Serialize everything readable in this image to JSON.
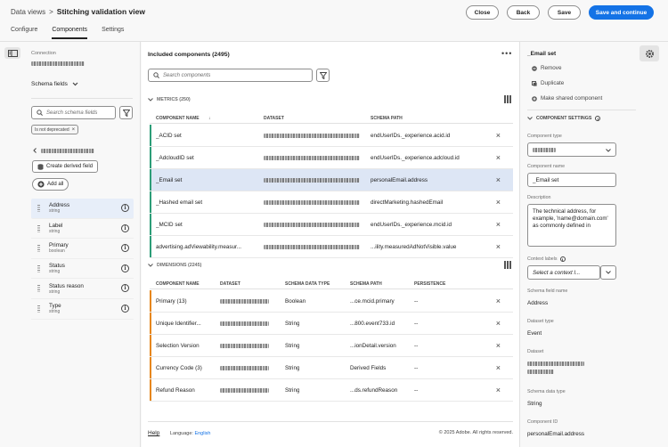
{
  "header": {
    "breadcrumb_root": "Data views",
    "breadcrumb_sep": ">",
    "title": "Stitching validation view",
    "close_label": "Close",
    "back_label": "Back",
    "save_label": "Save",
    "save_continue_label": "Save and continue",
    "tabs": [
      "Configure",
      "Components",
      "Settings"
    ]
  },
  "left": {
    "connection_label": "Connection",
    "schema_fields_label": "Schema fields",
    "search_placeholder": "Search schema fields",
    "filter_tag": "Is not deprecated",
    "create_derived_label": "Create derived field",
    "add_all_label": "Add all",
    "fields": [
      {
        "name": "Address",
        "type": "string"
      },
      {
        "name": "Label",
        "type": "string"
      },
      {
        "name": "Primary",
        "type": "boolean"
      },
      {
        "name": "Status",
        "type": "string"
      },
      {
        "name": "Status reason",
        "type": "string"
      },
      {
        "name": "Type",
        "type": "string"
      }
    ]
  },
  "center": {
    "title": "Included components (2495)",
    "search_placeholder": "Search components",
    "metrics_label": "METRICS (250)",
    "metrics_cols": [
      "COMPONENT NAME",
      "DATASET",
      "SCHEMA PATH"
    ],
    "metrics": [
      {
        "name": "_ACID set",
        "path": "endUserIDs._experience.acid.id"
      },
      {
        "name": "_AdcloudID set",
        "path": "endUserIDs._experience.adcloud.id"
      },
      {
        "name": "_Email set",
        "path": "personalEmail.address"
      },
      {
        "name": "_Hashed email set",
        "path": "directMarketing.hashedEmail"
      },
      {
        "name": "_MCID set",
        "path": "endUserIDs._experience.mcid.id"
      },
      {
        "name": "advertising.adViewability.measur...",
        "path": "...ility.measuredAdNotVisible.value"
      }
    ],
    "dimensions_label": "DIMENSIONS (2245)",
    "dimensions_cols": [
      "COMPONENT NAME",
      "DATASET",
      "SCHEMA DATA TYPE",
      "SCHEMA PATH",
      "PERSISTENCE"
    ],
    "dimensions": [
      {
        "name": "Primary (13)",
        "type": "Boolean",
        "path": "...ce.mcid.primary",
        "persist": "--"
      },
      {
        "name": "Unique Identifier...",
        "type": "String",
        "path": "...800.event733.id",
        "persist": "--"
      },
      {
        "name": "Selection Version",
        "type": "String",
        "path": "...ionDetail.version",
        "persist": "--"
      },
      {
        "name": "Currency Code (3)",
        "type": "String",
        "path": "Derived Fields",
        "persist": "--"
      },
      {
        "name": "Refund Reason",
        "type": "String",
        "path": "...ds.refundReason",
        "persist": "--"
      }
    ],
    "help_label": "Help",
    "language_label": "Language:",
    "language_value": "English",
    "copyright": "© 2025 Adobe. All rights reserved."
  },
  "right": {
    "title": "_Email set",
    "remove_label": "Remove",
    "duplicate_label": "Duplicate",
    "shared_label": "Make shared component",
    "settings_label": "COMPONENT SETTINGS",
    "type_label": "Component type",
    "name_label": "Component name",
    "name_value": "_Email set",
    "desc_label": "Description",
    "desc_value": "The technical address, for example, 'name@domain.com' as commonly defined in",
    "context_label": "Context labels",
    "context_placeholder": "Select a context l...",
    "schema_field_name_label": "Schema field name",
    "schema_field_name_value": "Address",
    "dataset_type_label": "Dataset type",
    "dataset_type_value": "Event",
    "dataset_label": "Dataset",
    "schema_data_type_label": "Schema data type",
    "schema_data_type_value": "String",
    "component_id_label": "Component ID",
    "component_id_value": "personalEmail.address"
  },
  "colors": {
    "accent": "#1473e6",
    "metric": "#2d9d78",
    "dimension": "#e68619",
    "selected": "#dde6f5"
  }
}
